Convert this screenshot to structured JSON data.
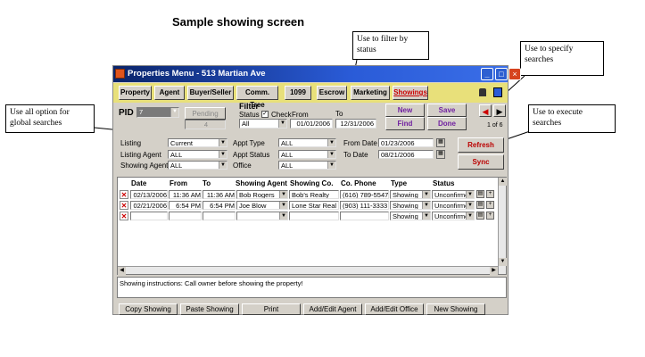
{
  "page": {
    "heading": "Sample showing screen"
  },
  "callouts": {
    "filter_status": "Use to filter by status",
    "specify_searches": "Use to specify searches",
    "global_searches": "Use all option for global searches",
    "execute_searches": "Use to execute searches"
  },
  "window": {
    "title": "Properties Menu - 513 Martian Ave",
    "minimize": "_",
    "maximize": "□",
    "close": "×"
  },
  "toolbar": {
    "tabs": [
      "Property",
      "Agent",
      "Buyer/Seller",
      "Comm. Tree",
      "1099",
      "Escrow",
      "Marketing",
      "Showings"
    ]
  },
  "pid": {
    "label": "PID",
    "value": "7",
    "pending": "Pending",
    "pending_count": "4"
  },
  "filter": {
    "title": "Filter",
    "status_label": "Status",
    "check_label": "Check",
    "from_label": "From",
    "to_label": "To",
    "status_value": "All",
    "check_checked": true,
    "from_value": "01/01/2006",
    "to_value": "12/31/2006"
  },
  "actions": {
    "new": "New",
    "save": "Save",
    "find": "Find",
    "done": "Done",
    "record_count": "1 of 6"
  },
  "search": {
    "listing_label": "Listing",
    "listing_value": "Current",
    "listing_agent_label": "Listing Agent",
    "listing_agent_value": "ALL",
    "showing_agent_label": "Showing Agent",
    "showing_agent_value": "ALL",
    "appt_type_label": "Appt Type",
    "appt_type_value": "ALL",
    "appt_status_label": "Appt Status",
    "appt_status_value": "ALL",
    "office_label": "Office",
    "office_value": "ALL",
    "from_date_label": "From Date",
    "from_date_value": "01/23/2006",
    "to_date_label": "To Date",
    "to_date_value": "08/21/2006",
    "refresh": "Refresh",
    "sync": "Sync"
  },
  "grid": {
    "columns": [
      "Date",
      "From",
      "To",
      "Showing Agent",
      "Showing Co.",
      "Co. Phone",
      "Type",
      "Status"
    ],
    "rows": [
      {
        "date": "02/13/2006",
        "from": "11:36 AM",
        "to": "11:36 AM",
        "agent": "Bob Rogers",
        "company": "Bob's Realty",
        "phone": "(616) 789-5547",
        "type": "Showing",
        "status": "Unconfirmed"
      },
      {
        "date": "02/21/2006",
        "from": "6:54 PM",
        "to": "6:54 PM",
        "agent": "Joe Blow",
        "company": "Lone Star Real Est",
        "phone": "(903) 111-3333",
        "type": "Showing",
        "status": "Unconfirmed"
      },
      {
        "date": "",
        "from": "",
        "to": "",
        "agent": "",
        "company": "",
        "phone": "",
        "type": "Showing",
        "status": "Unconfirmed"
      }
    ]
  },
  "instructions": "Showing instructions:  Call owner before showing the property!",
  "bottom_buttons": [
    "Copy Showing",
    "Paste Showing",
    "Print",
    "Add/Edit Agent",
    "Add/Edit Office",
    "New Showing"
  ]
}
